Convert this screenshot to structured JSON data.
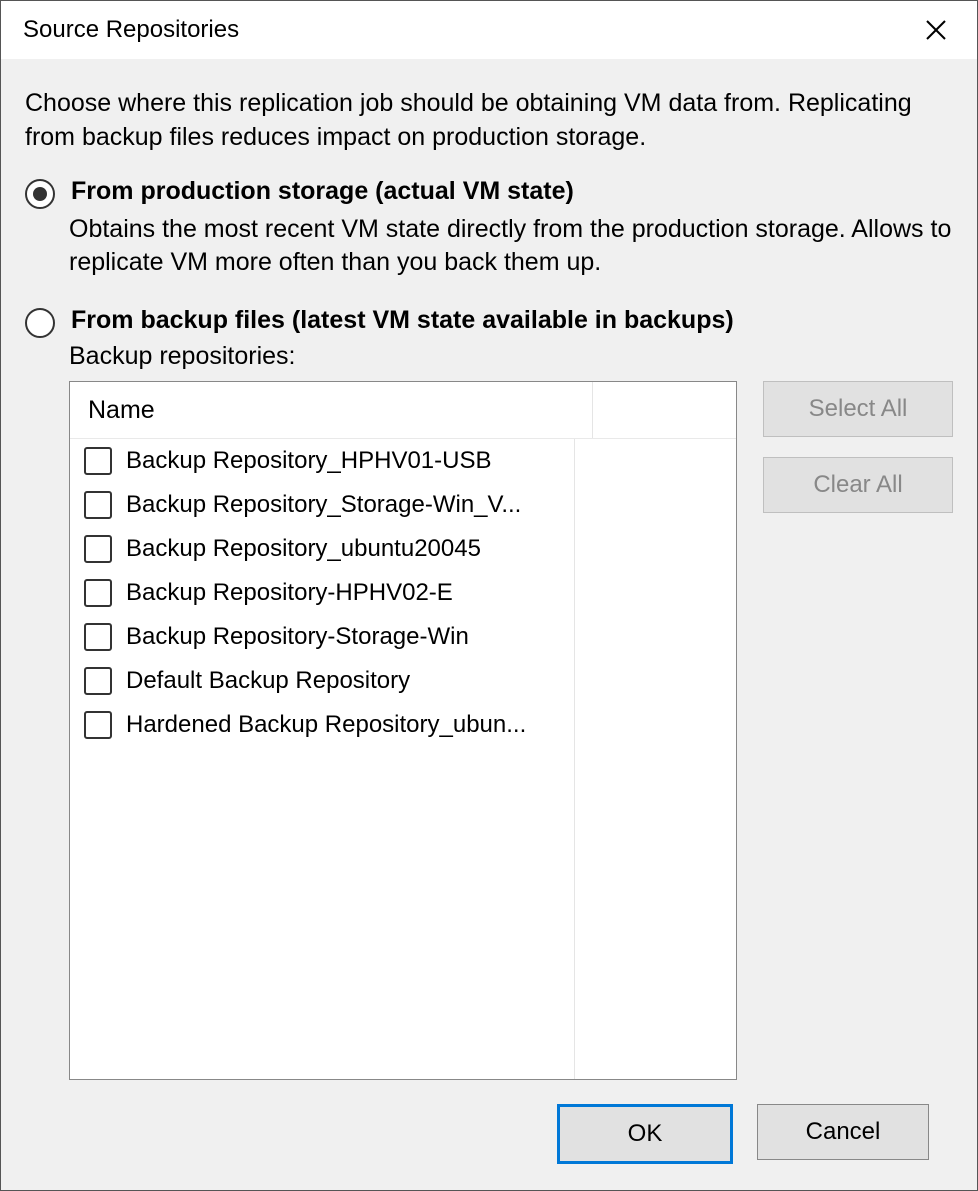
{
  "title": "Source Repositories",
  "intro": "Choose where this replication job should be obtaining VM data from. Replicating from backup files reduces impact on production storage.",
  "options": {
    "production": {
      "label": "From production storage (actual VM state)",
      "desc": "Obtains the most recent VM state directly from the production storage. Allows to replicate VM more often than you back them up.",
      "selected": true
    },
    "backup": {
      "label": "From backup files (latest VM state available in backups)",
      "selected": false
    }
  },
  "list": {
    "label": "Backup repositories:",
    "header": {
      "name": "Name"
    },
    "items": [
      {
        "label": "Backup Repository_HPHV01-USB",
        "checked": false
      },
      {
        "label": "Backup Repository_Storage-Win_V...",
        "checked": false
      },
      {
        "label": "Backup Repository_ubuntu20045",
        "checked": false
      },
      {
        "label": "Backup Repository-HPHV02-E",
        "checked": false
      },
      {
        "label": "Backup Repository-Storage-Win",
        "checked": false
      },
      {
        "label": "Default Backup Repository",
        "checked": false
      },
      {
        "label": "Hardened Backup Repository_ubun...",
        "checked": false
      }
    ]
  },
  "buttons": {
    "select_all": "Select All",
    "clear_all": "Clear All",
    "ok": "OK",
    "cancel": "Cancel"
  }
}
